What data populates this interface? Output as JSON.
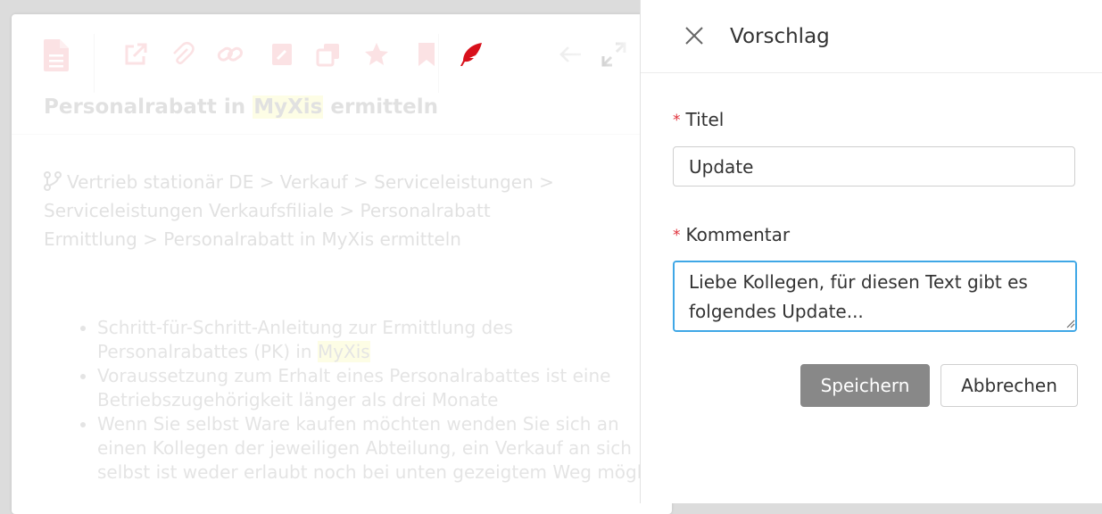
{
  "document": {
    "title_before": "Personalrabatt in ",
    "title_highlight": "MyXis",
    "title_after": " ermitteln",
    "breadcrumb": "Vertrieb stationär DE > Verkauf > Serviceleistungen > Serviceleistungen Verkaufsfiliale > Personalrabatt Ermittlung > Personalrabatt in MyXis ermitteln",
    "bullets": [
      {
        "text": "Schritt-für-Schritt-Anleitung zur Ermittlung des Personalrabattes (PK) in ",
        "highlight": "MyXis"
      },
      {
        "text": "Voraussetzung zum Erhalt eines Personalrabattes ist eine Betriebszugehörigkeit länger als drei Monate",
        "highlight": ""
      },
      {
        "text": "Wenn Sie selbst Ware kaufen möchten wenden Sie sich an einen Kollegen der jeweiligen Abteilung, ein Verkauf an sich selbst ist weder erlaubt noch bei unten gezeigtem Weg möglich",
        "highlight": ""
      }
    ],
    "toolbar_icons": [
      "document-icon",
      "external-link-icon",
      "paperclip-icon",
      "link-icon",
      "edit-note-icon",
      "copy-icon",
      "star-icon",
      "bookmark-icon",
      "feather-icon",
      "arrow-left-icon",
      "expand-icon"
    ],
    "colors": {
      "icon_accent": "#e8505b",
      "feather_active": "#d8101b",
      "highlight": "#f3f25a"
    }
  },
  "panel": {
    "title": "Vorschlag",
    "title_field": {
      "label": "Titel",
      "required_marker": "*",
      "value": "Update"
    },
    "comment_field": {
      "label": "Kommentar",
      "required_marker": "*",
      "value": "Liebe Kollegen, für diesen Text gibt es folgendes Update..."
    },
    "save_label": "Speichern",
    "cancel_label": "Abbrechen",
    "colors": {
      "focus_border": "#3fa7e6",
      "required": "#e0303a",
      "primary_button": "#888888"
    }
  }
}
